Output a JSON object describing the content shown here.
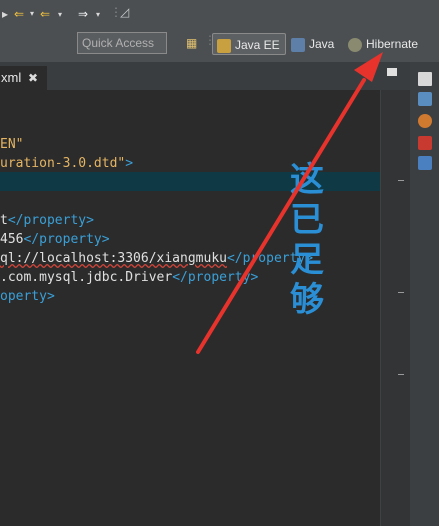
{
  "toolbar": {
    "quick_access_placeholder": "Quick Access",
    "perspectives": [
      {
        "label": "Java EE"
      },
      {
        "label": "Java"
      },
      {
        "label": "Hibernate"
      }
    ]
  },
  "editor_tab": {
    "label": "xml",
    "close_symbol": "✖"
  },
  "code_lines": [
    {
      "segments": [
        {
          "text": "EN\"",
          "kind": "str"
        }
      ]
    },
    {
      "segments": [
        {
          "text": "uration-3.0.dtd\"",
          "kind": "str"
        },
        {
          "text": ">",
          "kind": "tag"
        }
      ]
    },
    {
      "segments": [
        {
          "text": "",
          "kind": "plain"
        }
      ]
    },
    {
      "segments": [
        {
          "text": "t",
          "kind": "plain"
        },
        {
          "text": "</property>",
          "kind": "tag"
        }
      ]
    },
    {
      "segments": [
        {
          "text": "456",
          "kind": "plain"
        },
        {
          "text": "</property>",
          "kind": "tag"
        }
      ]
    },
    {
      "segments": [
        {
          "text": "ql://localhost:3306/xiangmuku",
          "kind": "plain",
          "underline": true
        },
        {
          "text": "</property>",
          "kind": "tag"
        }
      ]
    },
    {
      "segments": [
        {
          "text": ".com.mysql.jdbc.Driver",
          "kind": "plain"
        },
        {
          "text": "</property>",
          "kind": "tag"
        }
      ]
    },
    {
      "segments": [
        {
          "text": "operty>",
          "kind": "tag"
        }
      ]
    }
  ],
  "annotation": {
    "chars": [
      "这",
      "已",
      "足",
      "够"
    ],
    "color": "#2b8fd6"
  },
  "colors": {
    "toolbar_bg": "#4b4f52",
    "editor_bg": "#2b2b2b",
    "string": "#e5b563",
    "tag": "#3aa0d8",
    "arrow": "#e8332d"
  },
  "icons": {
    "toolbar": [
      "debug-icon",
      "back-arrow-icon",
      "back-dropdown-icon",
      "forward-arrow-icon",
      "forward-dropdown-icon",
      "pin-editor-icon"
    ],
    "open_perspective": "open-perspective-icon",
    "javaee": "javaee-perspective-icon",
    "java": "java-perspective-icon",
    "hibernate": "hibernate-perspective-icon",
    "trim": [
      "restore-icon",
      "outline-icon",
      "hierarchy-icon",
      "servers-icon",
      "console-icon"
    ]
  }
}
